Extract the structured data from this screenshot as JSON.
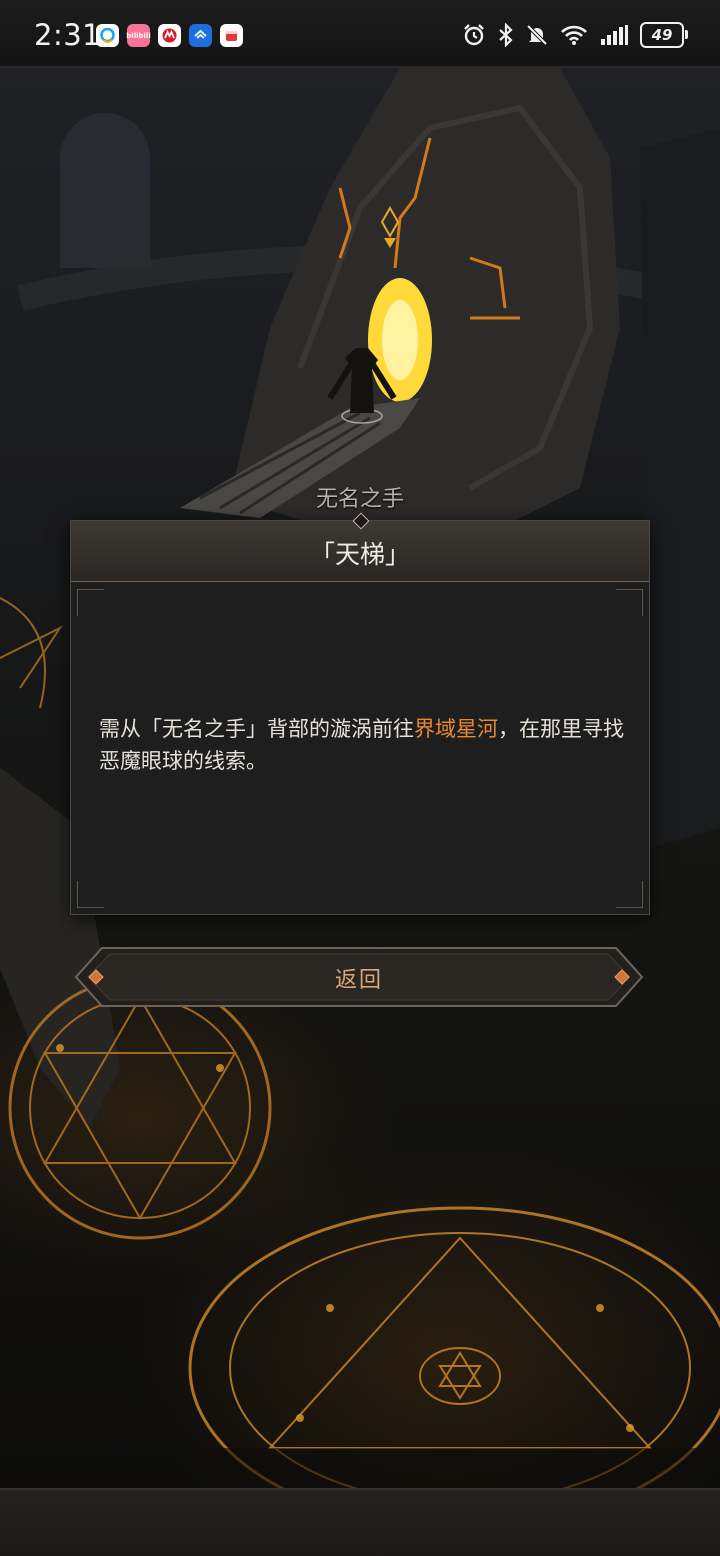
{
  "status_bar": {
    "time": "2:31",
    "apps": [
      {
        "name": "qq-app-icon",
        "color": "#ffffff"
      },
      {
        "name": "bilibili-app-icon",
        "color": "#fb7299",
        "label": "bilibili"
      },
      {
        "name": "cmb-bank-app-icon",
        "color": "#ffffff"
      },
      {
        "name": "blue-app-icon",
        "color": "#1e6fe0"
      },
      {
        "name": "red-app-icon",
        "color": "#ffffff"
      }
    ],
    "battery_level": "49"
  },
  "scene": {
    "npc_name": "无名之手"
  },
  "dialog": {
    "title": "「天梯」",
    "body_prefix": "需从「无名之手」背部的漩涡前往",
    "body_highlight": "界域星河",
    "body_suffix": "，在那里寻找恶魔眼球的线索。",
    "highlight_color": "#e8892f"
  },
  "buttons": {
    "return_label": "返回"
  }
}
